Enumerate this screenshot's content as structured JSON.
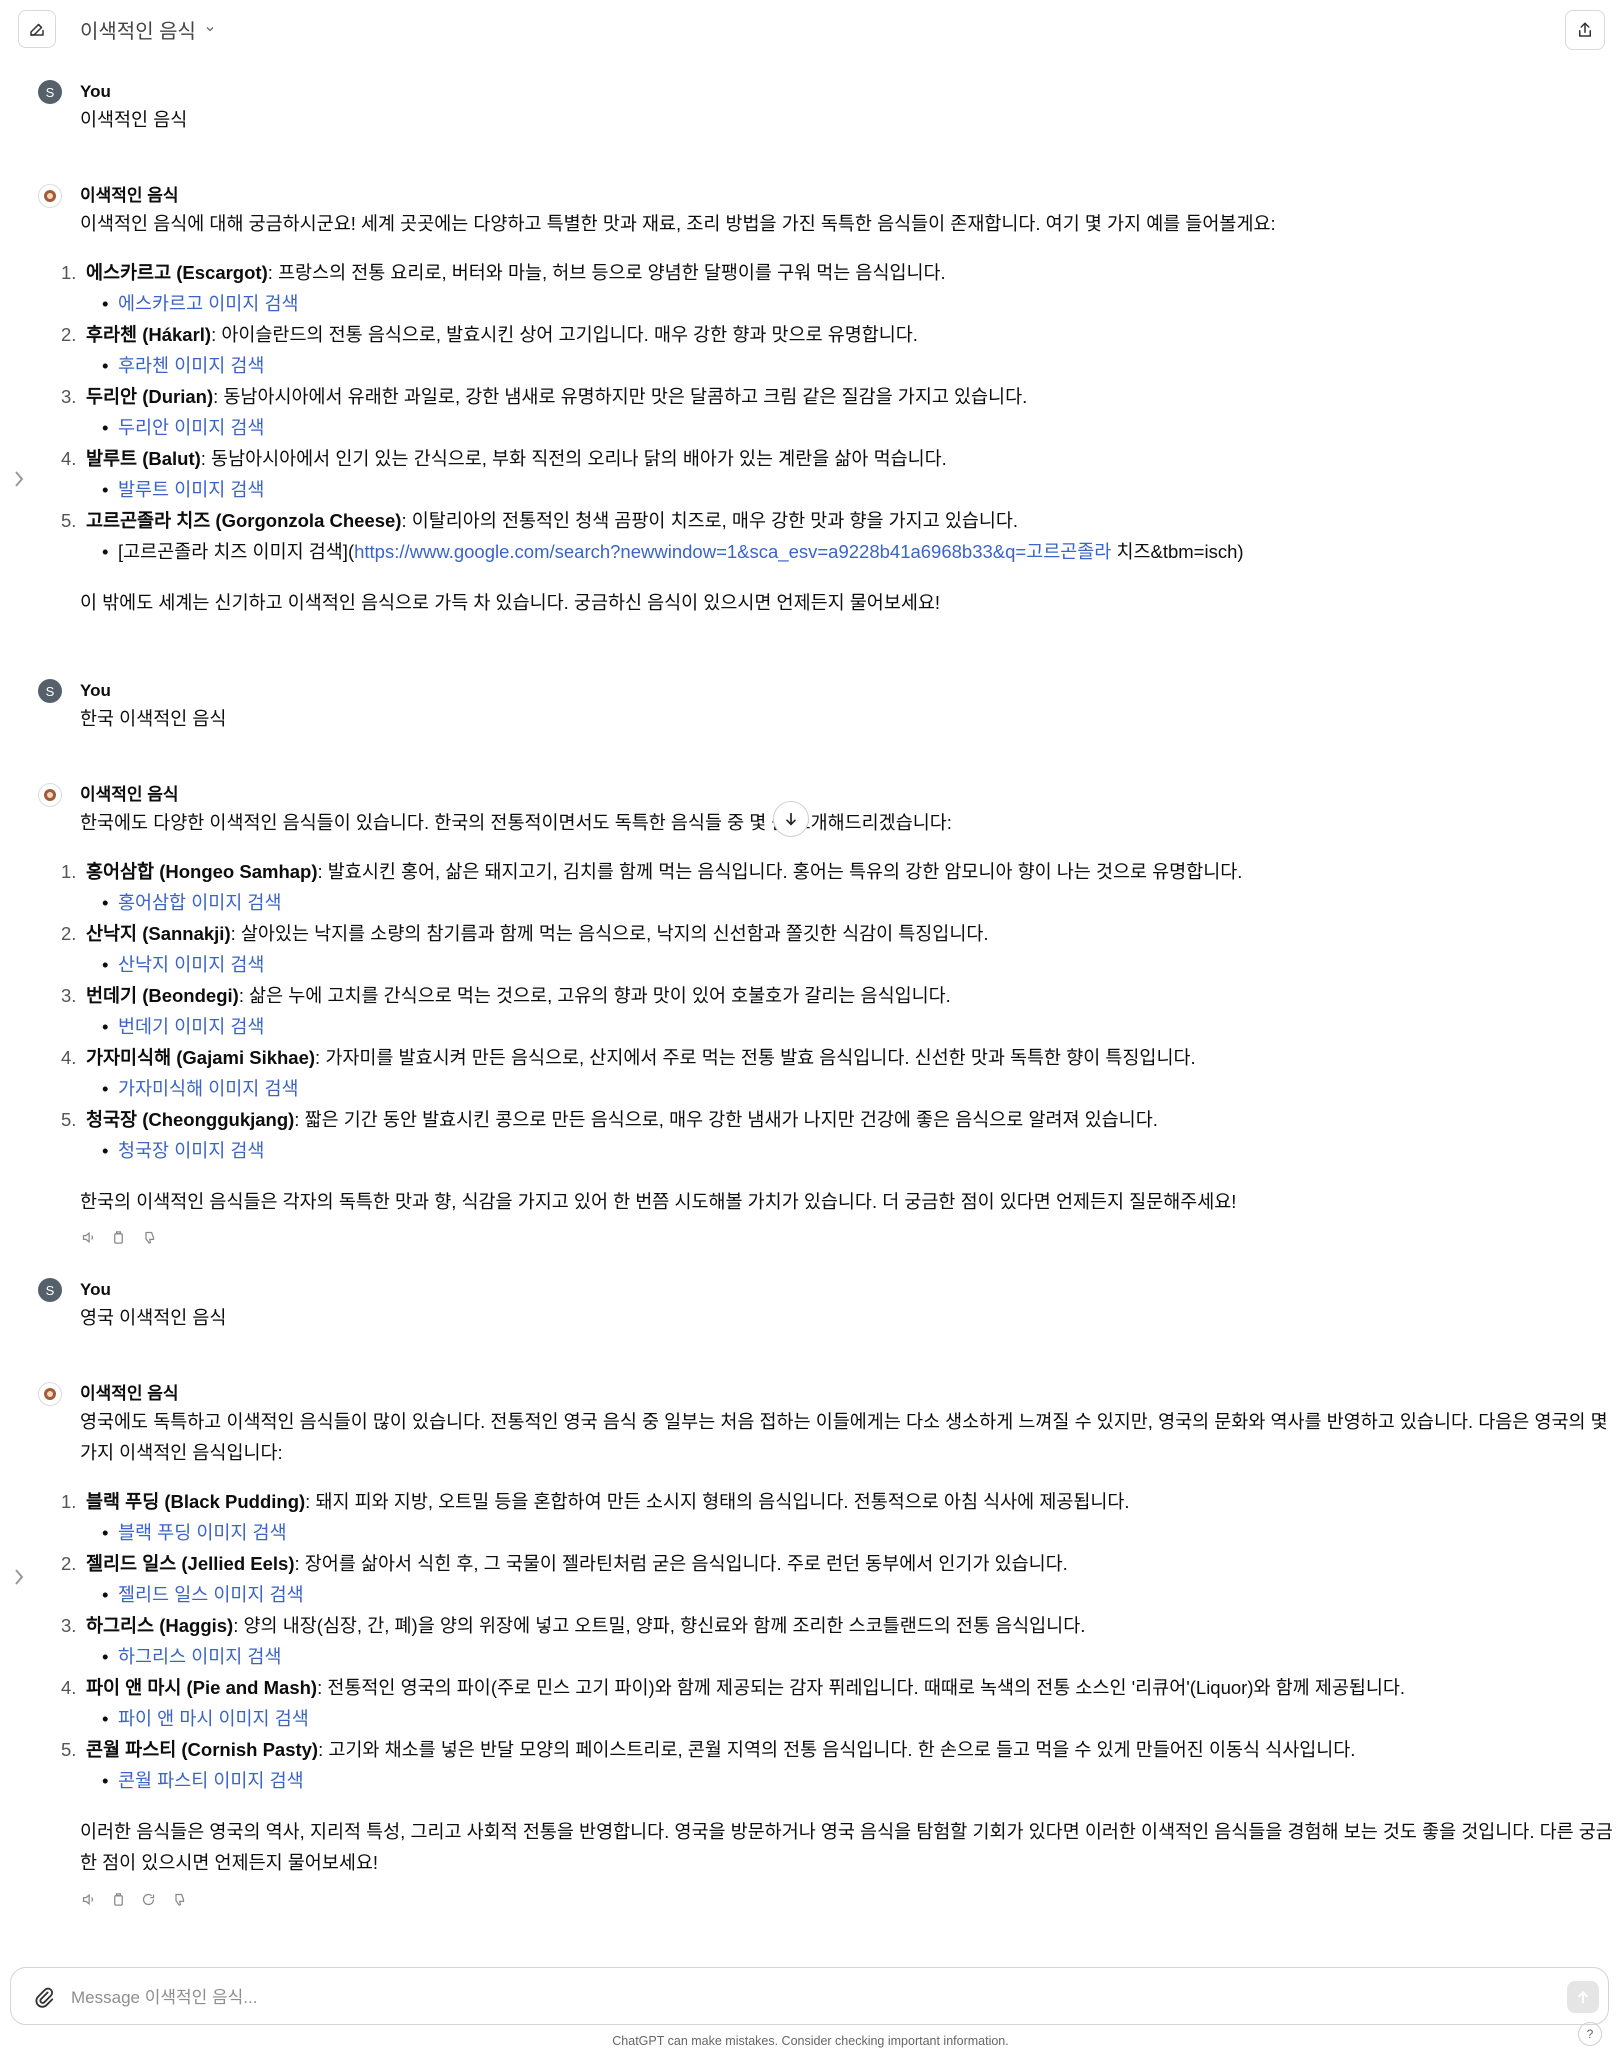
{
  "header": {
    "title": "이색적인 음식"
  },
  "messages": [
    {
      "author": "You",
      "avatar": "S",
      "text": "이색적인 음식"
    },
    {
      "author": "이색적인 음식",
      "intro": "이색적인 음식에 대해 궁금하시군요! 세계 곳곳에는 다양하고 특별한 맛과 재료, 조리 방법을 가진 독특한 음식들이 존재합니다. 여기 몇 가지 예를 들어볼게요:",
      "items": [
        {
          "n": "1.",
          "name": "에스카르고 (Escargot)",
          "desc": ": 프랑스의 전통 요리로, 버터와 마늘, 허브 등으로 양념한 달팽이를 구워 먹는 음식입니다.",
          "link": "에스카르고 이미지 검색"
        },
        {
          "n": "2.",
          "name": "후라첸 (Hákarl)",
          "desc": ": 아이슬란드의 전통 음식으로, 발효시킨 상어 고기입니다. 매우 강한 향과 맛으로 유명합니다.",
          "link": "후라첸 이미지 검색"
        },
        {
          "n": "3.",
          "name": "두리안 (Durian)",
          "desc": ": 동남아시아에서 유래한 과일로, 강한 냄새로 유명하지만 맛은 달콤하고 크림 같은 질감을 가지고 있습니다.",
          "link": "두리안 이미지 검색"
        },
        {
          "n": "4.",
          "name": "발루트 (Balut)",
          "desc": ": 동남아시아에서 인기 있는 간식으로, 부화 직전의 오리나 닭의 배아가 있는 계란을 삶아 먹습니다.",
          "link": "발루트 이미지 검색"
        },
        {
          "n": "5.",
          "name": "고르곤졸라 치즈 (Gorgonzola Cheese)",
          "desc": ": 이탈리아의 전통적인 청색 곰팡이 치즈로, 매우 강한 맛과 향을 가지고 있습니다.",
          "raw_pre": "[고르곤졸라 치즈 이미지 검색](",
          "raw_link": "https://www.google.com/search?newwindow=1&sca_esv=a9228b41a6968b33&q=고르곤졸라",
          "raw_post": " 치즈&tbm=isch)"
        }
      ],
      "outro": "이 밖에도 세계는 신기하고 이색적인 음식으로 가득 차 있습니다. 궁금하신 음식이 있으시면 언제든지 물어보세요!"
    },
    {
      "author": "You",
      "avatar": "S",
      "text": "한국 이색적인 음식"
    },
    {
      "author": "이색적인 음식",
      "intro": "한국에도 다양한 이색적인 음식들이 있습니다. 한국의 전통적이면서도 독특한 음식들 중 몇      를 소개해드리겠습니다:",
      "items": [
        {
          "n": "1.",
          "name": "홍어삼합 (Hongeo Samhap)",
          "desc": ": 발효시킨 홍어, 삶은 돼지고기, 김치를 함께 먹는 음식입니다. 홍어는 특유의 강한 암모니아 향이 나는 것으로 유명합니다.",
          "link": "홍어삼합 이미지 검색"
        },
        {
          "n": "2.",
          "name": "산낙지 (Sannakji)",
          "desc": ": 살아있는 낙지를 소량의 참기름과 함께 먹는 음식으로, 낙지의 신선함과 쫄깃한 식감이 특징입니다.",
          "link": "산낙지 이미지 검색"
        },
        {
          "n": "3.",
          "name": "번데기 (Beondegi)",
          "desc": ": 삶은 누에 고치를 간식으로 먹는 것으로, 고유의 향과 맛이 있어 호불호가 갈리는 음식입니다.",
          "link": "번데기 이미지 검색"
        },
        {
          "n": "4.",
          "name": "가자미식해 (Gajami Sikhae)",
          "desc": ": 가자미를 발효시켜 만든 음식으로, 산지에서 주로 먹는 전통 발효 음식입니다. 신선한 맛과 독특한 향이 특징입니다.",
          "link": "가자미식해 이미지 검색"
        },
        {
          "n": "5.",
          "name": "청국장 (Cheonggukjang)",
          "desc": ": 짧은 기간 동안 발효시킨 콩으로 만든 음식으로, 매우 강한 냄새가 나지만 건강에 좋은 음식으로 알려져 있습니다.",
          "link": "청국장 이미지 검색"
        }
      ],
      "outro": "한국의 이색적인 음식들은 각자의 독특한 맛과 향, 식감을 가지고 있어 한 번쯤 시도해볼 가치가 있습니다. 더 궁금한 점이 있다면 언제든지 질문해주세요!"
    },
    {
      "author": "You",
      "avatar": "S",
      "text": "영국 이색적인 음식"
    },
    {
      "author": "이색적인 음식",
      "intro": "영국에도 독특하고 이색적인 음식들이 많이 있습니다. 전통적인 영국 음식 중 일부는 처음 접하는 이들에게는 다소 생소하게 느껴질 수 있지만, 영국의 문화와 역사를 반영하고 있습니다. 다음은 영국의 몇 가지 이색적인 음식입니다:",
      "items": [
        {
          "n": "1.",
          "name": "블랙 푸딩 (Black Pudding)",
          "desc": ": 돼지 피와 지방, 오트밀 등을 혼합하여 만든 소시지 형태의 음식입니다. 전통적으로 아침 식사에 제공됩니다.",
          "link": "블랙 푸딩 이미지 검색"
        },
        {
          "n": "2.",
          "name": "젤리드 일스 (Jellied Eels)",
          "desc": ": 장어를 삶아서 식힌 후, 그 국물이 젤라틴처럼 굳은 음식입니다. 주로 런던 동부에서 인기가 있습니다.",
          "link": "젤리드 일스 이미지 검색"
        },
        {
          "n": "3.",
          "name": "하그리스 (Haggis)",
          "desc": ": 양의 내장(심장, 간, 폐)을 양의 위장에 넣고 오트밀, 양파, 향신료와 함께 조리한 스코틀랜드의 전통 음식입니다.",
          "link": "하그리스 이미지 검색"
        },
        {
          "n": "4.",
          "name": "파이 앤 마시 (Pie and Mash)",
          "desc": ": 전통적인 영국의 파이(주로 민스 고기 파이)와 함께 제공되는 감자 퓌레입니다. 때때로 녹색의 전통 소스인 '리큐어'(Liquor)와 함께 제공됩니다.",
          "link": "파이 앤 마시 이미지 검색"
        },
        {
          "n": "5.",
          "name": "콘월 파스티 (Cornish Pasty)",
          "desc": ": 고기와 채소를 넣은 반달 모양의 페이스트리로, 콘월 지역의 전통 음식입니다. 한 손으로 들고 먹을 수 있게 만들어진 이동식 식사입니다.",
          "link": "콘월 파스티 이미지 검색"
        }
      ],
      "outro": "이러한 음식들은 영국의 역사, 지리적 특성, 그리고 사회적 전통을 반영합니다. 영국을 방문하거나 영국 음식을 탐험할 기회가 있다면 이러한 이색적인 음식들을 경험해 보는 것도 좋을 것입니다. 다른 궁금한 점이 있으시면 언제든지 물어보세요!"
    }
  ],
  "composer": {
    "placeholder": "Message 이색적인 음식..."
  },
  "footer": {
    "disclaimer": "ChatGPT can make mistakes. Consider checking important information.",
    "help": "?"
  },
  "colors": {
    "link": "#3a64c8",
    "avatar_user": "#56606a"
  }
}
